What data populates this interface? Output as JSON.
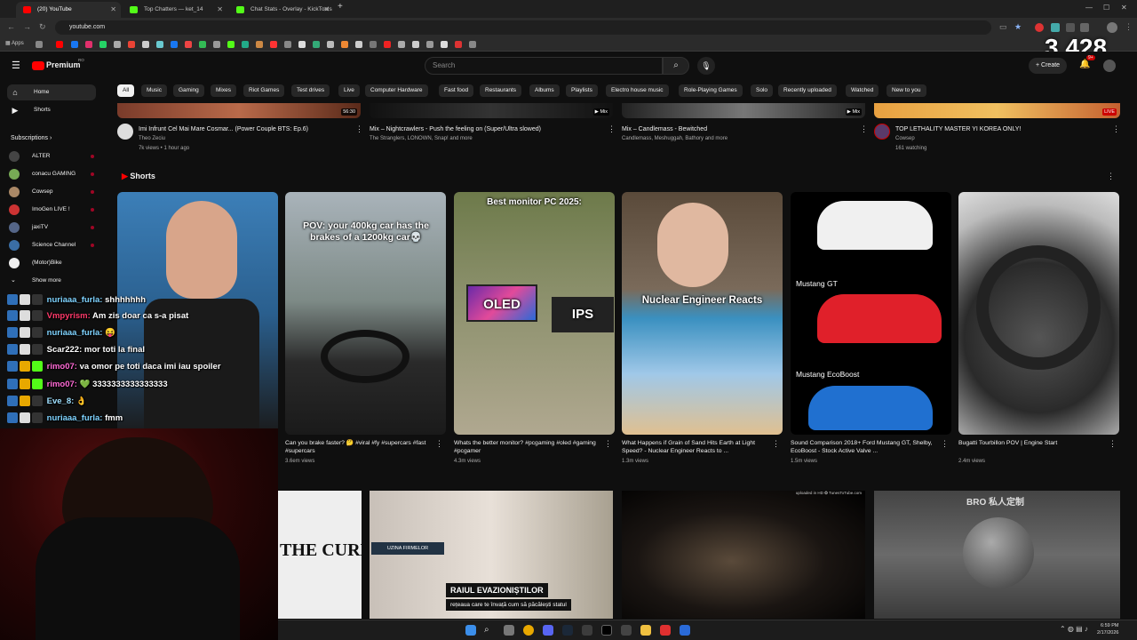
{
  "browser": {
    "tabs": [
      {
        "label": "(20) YouTube",
        "color": "#ff0000"
      },
      {
        "label": "Top Chatters — ket_14",
        "color": "#53fc18"
      },
      {
        "label": "Chat Stats - Overlay - KickTools",
        "color": "#53fc18"
      }
    ],
    "url": "youtube.com",
    "apps_label": "Apps",
    "new_tab": "+"
  },
  "viewer_count": "3,428",
  "youtube": {
    "logo": "Premium",
    "logo_sup": "RO",
    "search_placeholder": "Search",
    "create_label": "Create",
    "notif_badge": "9+",
    "chips": [
      "All",
      "Music",
      "Gaming",
      "Mixes",
      "Riot Games",
      "Test drives",
      "Live",
      "Computer Hardware",
      "Fast food",
      "Restaurants",
      "Albums",
      "Playlists",
      "Electro house music",
      "Role-Playing Games",
      "Solo",
      "Recently uploaded",
      "Watched",
      "New to you"
    ],
    "sidebar": {
      "home": "Home",
      "shorts": "Shorts",
      "subscriptions": "Subscriptions",
      "subs": [
        "ALTER",
        "conacu GAMING",
        "Cowsep",
        "ImoGen LIVE !",
        "jaxiTV",
        "Science Channel",
        "(Motor)Bike"
      ],
      "show_more": "Show more"
    },
    "top_videos": [
      {
        "title": "Imi Infrunt Cel Mai Mare Cosmar... (Power Couple BTS: Ep.6)",
        "channel": "Theo Zeciu",
        "meta": "7k views • 1 hour ago",
        "badge": "56:30"
      },
      {
        "title": "Mix – Nightcrawlers - Push the feeling on (Super/Ultra slowed)",
        "channel": "The Stranglers, LONOWN, Snap! and more",
        "meta": "",
        "badge": "Mix"
      },
      {
        "title": "Mix – Candlemass - Bewitched",
        "channel": "Candlemass, Meshuggah, Bathory and more",
        "meta": "",
        "badge": "Mix"
      },
      {
        "title": "TOP LETHALITY MASTER YI KOREA ONLY!",
        "channel": "Cowsep",
        "meta": "161 watching",
        "badge": "LIVE"
      }
    ],
    "shorts_heading": "Shorts",
    "shorts": [
      {
        "title": "",
        "views": "",
        "overlay": ""
      },
      {
        "title": "Can you brake faster? 🤔 #viral #fy #supercars #fast #supercars",
        "views": "3.6em views",
        "overlay": "POV: your 400kg car has the brakes of a 1200kg car💀"
      },
      {
        "title": "Whats the better monitor? #pcgaming #oled #gaming #pcgamer",
        "views": "4.3m views",
        "overlay": "Best monitor PC 2025:"
      },
      {
        "title": "What Happens if Grain of Sand Hits Earth at Light Speed? - Nuclear Engineer Reacts to ...",
        "views": "1.3m views",
        "overlay": "Nuclear Engineer Reacts"
      },
      {
        "title": "Sound Comparison 2018+ Ford Mustang GT, Shelby, EcoBoost - Stock Active Valve ...",
        "views": "1.5m views",
        "overlay": "Mustang GT"
      },
      {
        "title": "Bugatti Tourbillon POV | Engine Start",
        "views": "2.4m views",
        "overlay": ""
      }
    ],
    "shorts_extra": {
      "oled": "OLED",
      "ips": "IPS",
      "ecoboost": "Mustang EcoBoost"
    },
    "bottom_tiles": {
      "news_caption": "RAIUL EVAZIONIȘTILOR",
      "news_sub": "rețeaua care te învață cum să păcălești statul",
      "news_sign": "UZINA FIRMELOR",
      "upload_note": "uploaded in HD ✪ TunesToTube.com",
      "band_text": "THE CURE",
      "bro_text": "BRO 私人定制"
    }
  },
  "chat": [
    {
      "user": "nuriaaa_furla:",
      "msg": "shhhhhhh"
    },
    {
      "user": "Vmpyrism:",
      "msg": "Am zis doar ca s-a pisat"
    },
    {
      "user": "nuriaaa_furla:",
      "msg": "😝"
    },
    {
      "user": "Scar222:",
      "msg": "mor toti la final"
    },
    {
      "user": "rimo07:",
      "msg": "va omor pe toti daca imi iau spoiler"
    },
    {
      "user": "rimo07:",
      "msg": "💚 3333333333333333"
    },
    {
      "user": "Eve_8:",
      "msg": "👌"
    },
    {
      "user": "nuriaaa_furla:",
      "msg": "fmm"
    }
  ],
  "taskbar": {
    "time": "6:59 PM",
    "date": "2/17/2026"
  },
  "icons": [
    "youtube-icon",
    "kick-icon",
    "search-icon",
    "mic-icon",
    "bell-icon",
    "menu-icon",
    "home-icon",
    "shorts-icon",
    "chevron-icon"
  ]
}
